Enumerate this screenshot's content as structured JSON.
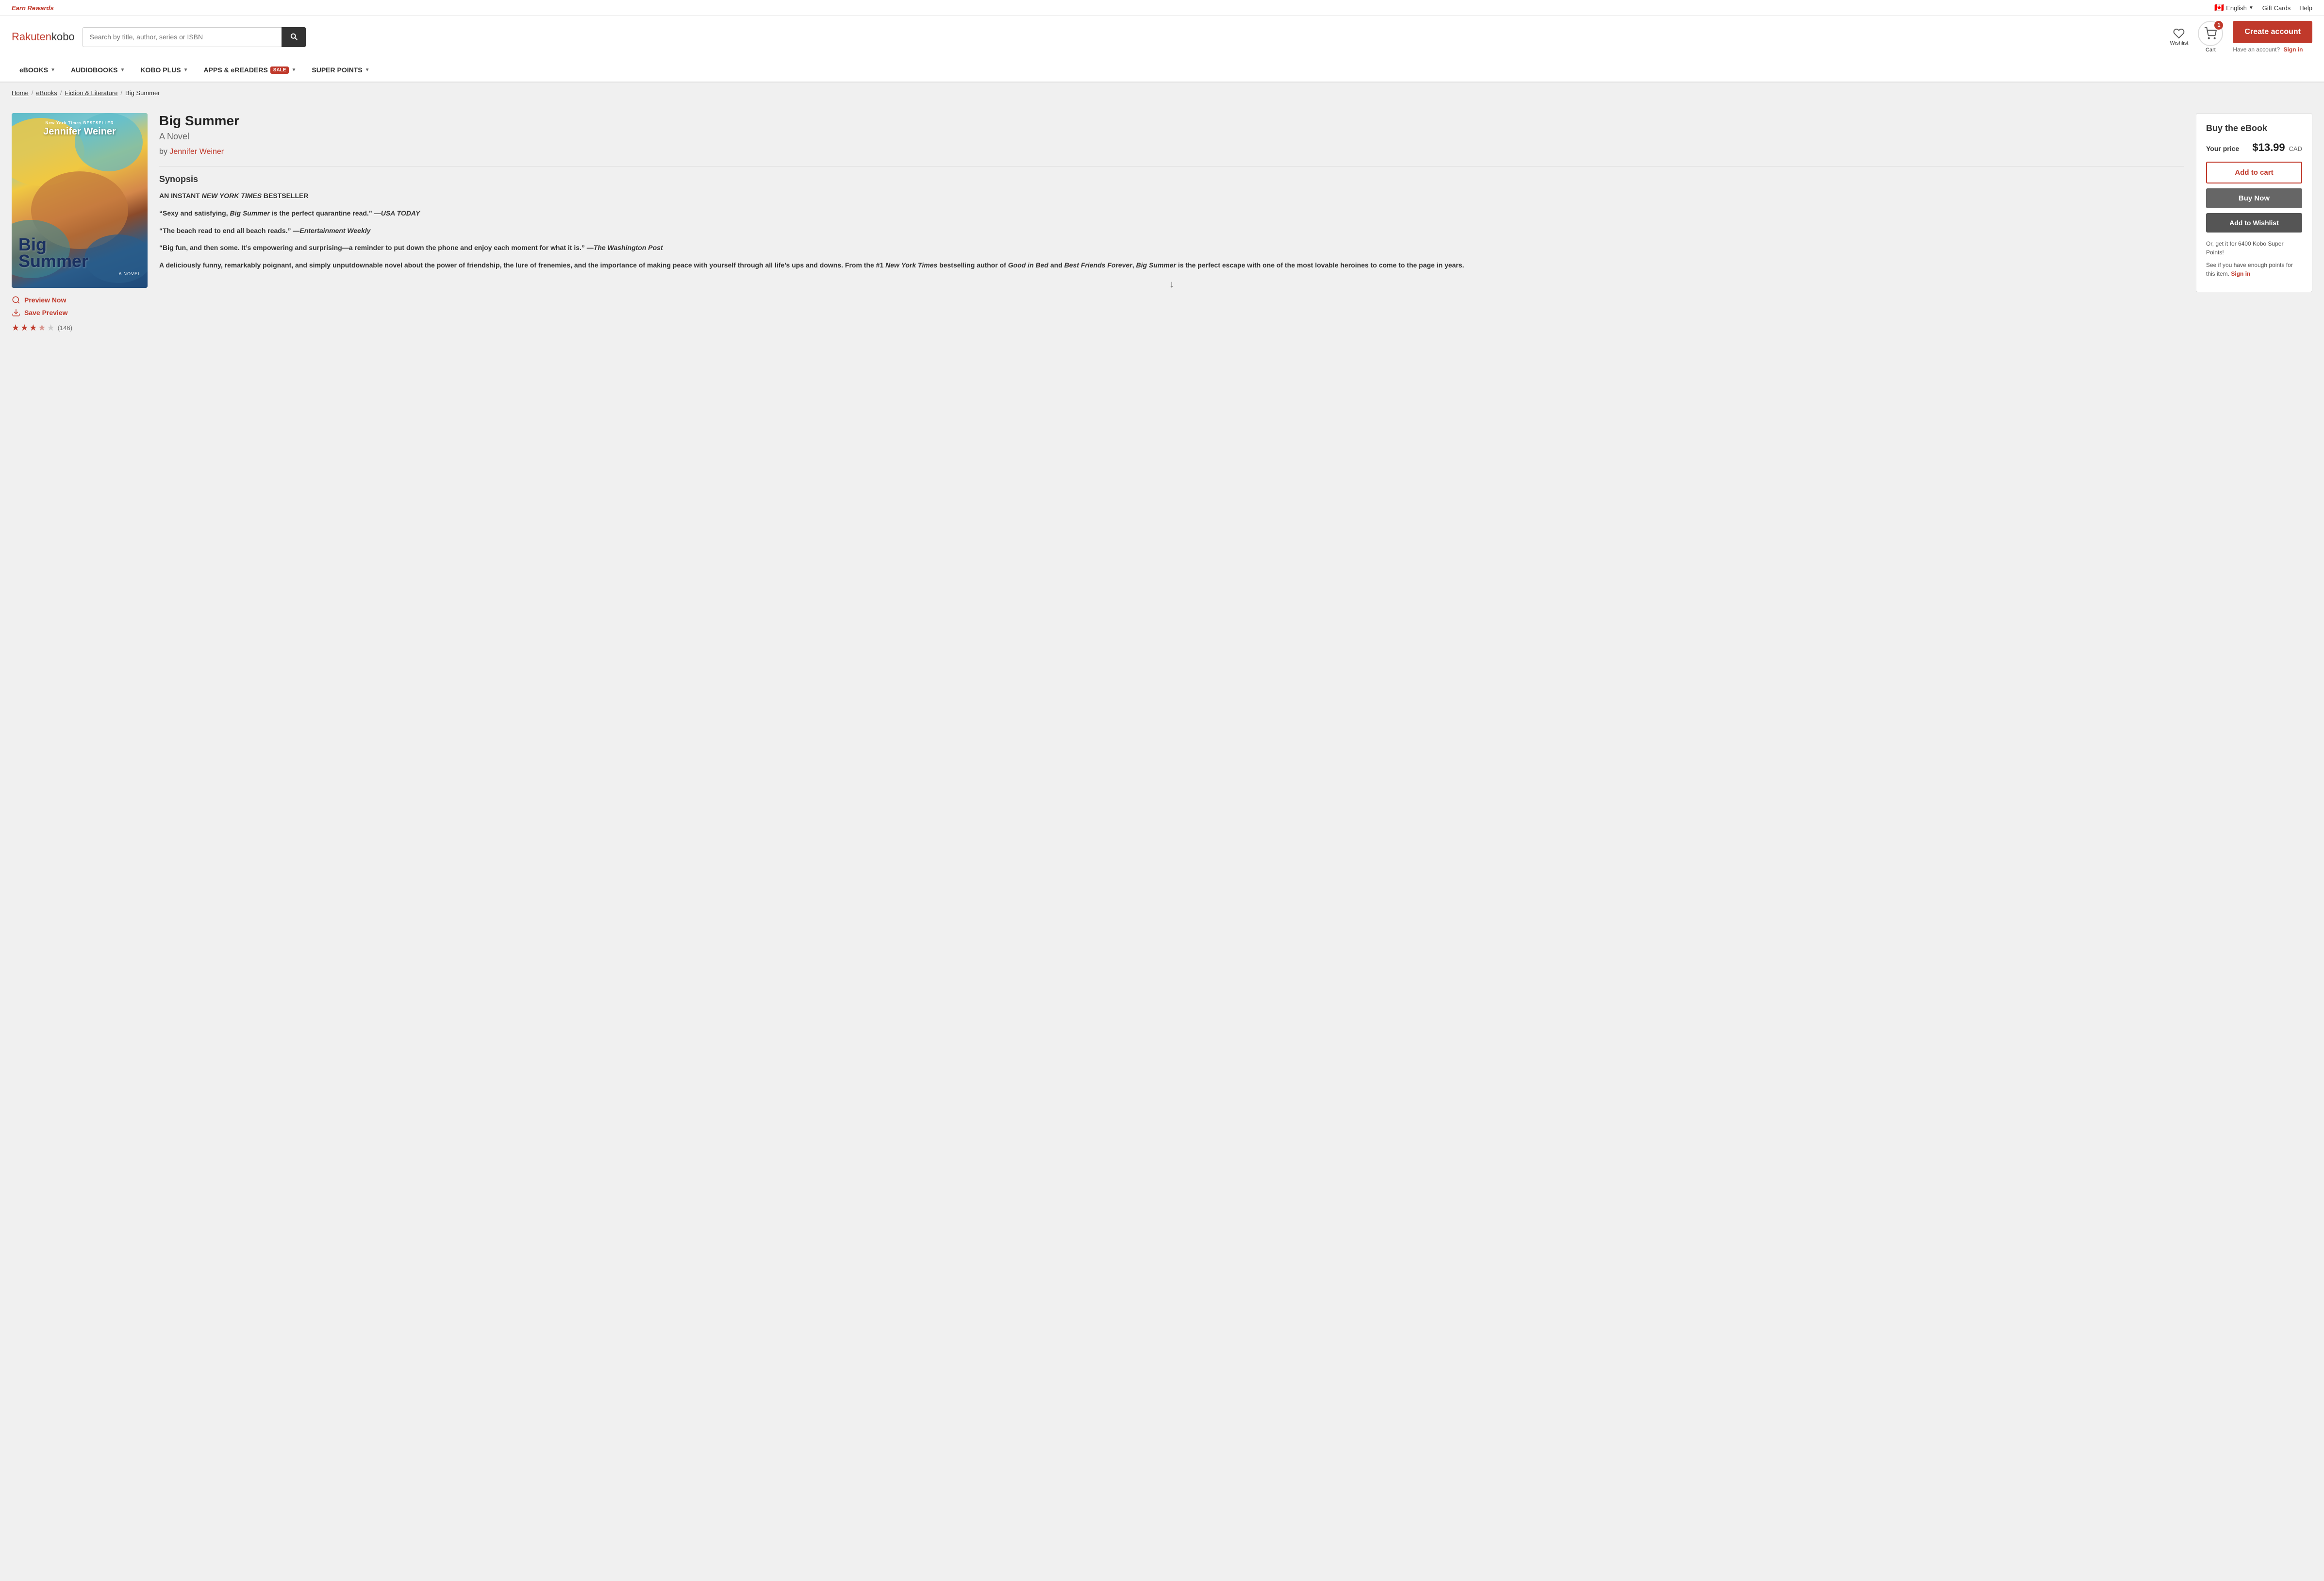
{
  "topbar": {
    "earn_rewards": "Earn Rewards",
    "language": "English",
    "gift_cards": "Gift Cards",
    "help": "Help"
  },
  "header": {
    "logo_rakuten": "Rakuten",
    "logo_kobo": " kobo",
    "search_placeholder": "Search by title, author, series or ISBN",
    "wishlist_label": "Wishlist",
    "cart_label": "Cart",
    "cart_count": "1",
    "create_account": "Create account",
    "have_account": "Have an account?",
    "sign_in": "Sign in"
  },
  "nav": {
    "items": [
      {
        "label": "eBOOKS",
        "has_dropdown": true
      },
      {
        "label": "AUDIOBOOKS",
        "has_dropdown": true
      },
      {
        "label": "KOBO PLUS",
        "has_dropdown": true
      },
      {
        "label": "APPS & eREADERS",
        "has_dropdown": true,
        "has_sale": true
      },
      {
        "label": "SUPER POINTS",
        "has_dropdown": true
      }
    ],
    "sale_label": "SALE"
  },
  "breadcrumb": {
    "home": "Home",
    "ebooks": "eBooks",
    "category": "Fiction & Literature",
    "current": "Big Summer"
  },
  "book": {
    "title": "Big Summer",
    "subtitle": "A Novel",
    "author_prefix": "by",
    "author": "Jennifer Weiner",
    "cover_author": "Jennifer Weiner",
    "cover_nyt": "New York Times BESTSELLER",
    "cover_title_line1": "Big",
    "cover_title_line2": "Summer",
    "cover_novel": "A NOVEL",
    "synopsis_title": "Synopsis",
    "synopsis_line1": "AN INSTANT NEW YORK TIMES BESTSELLER",
    "synopsis_q1": "“Sexy and satisfying, Big Summer is the perfect quarantine read.” —USA TODAY",
    "synopsis_q2": "“The beach read to end all beach reads.” —Entertainment Weekly",
    "synopsis_q3": "“Big fun, and then some. It’s empowering and surprising—a reminder to put down the phone and enjoy each moment for what it is.” —The Washington Post",
    "synopsis_body": "A deliciously funny, remarkably poignant, and simply unputdownable novel about the power of friendship, the lure of frenemies, and the importance of making peace with yourself through all life’s ups and downs. From the #1 New York Times bestselling author of Good in Bed and Best Friends Forever, Big Summer is the perfect escape with one of the most lovable heroines to come to the page in years.",
    "preview_now": "Preview Now",
    "save_preview": "Save Preview",
    "rating_count": "(146)",
    "stars_full": 3.5,
    "stars_count": 5
  },
  "buy_panel": {
    "title": "Buy the eBook",
    "price_label": "Your price",
    "price": "$13.99",
    "currency": "CAD",
    "add_to_cart": "Add to cart",
    "buy_now": "Buy Now",
    "add_to_wishlist": "Add to Wishlist",
    "super_points_text": "Or, get it for 6400 Kobo Super Points!",
    "see_points": "See if you have enough points for this item.",
    "sign_in": "Sign in"
  }
}
